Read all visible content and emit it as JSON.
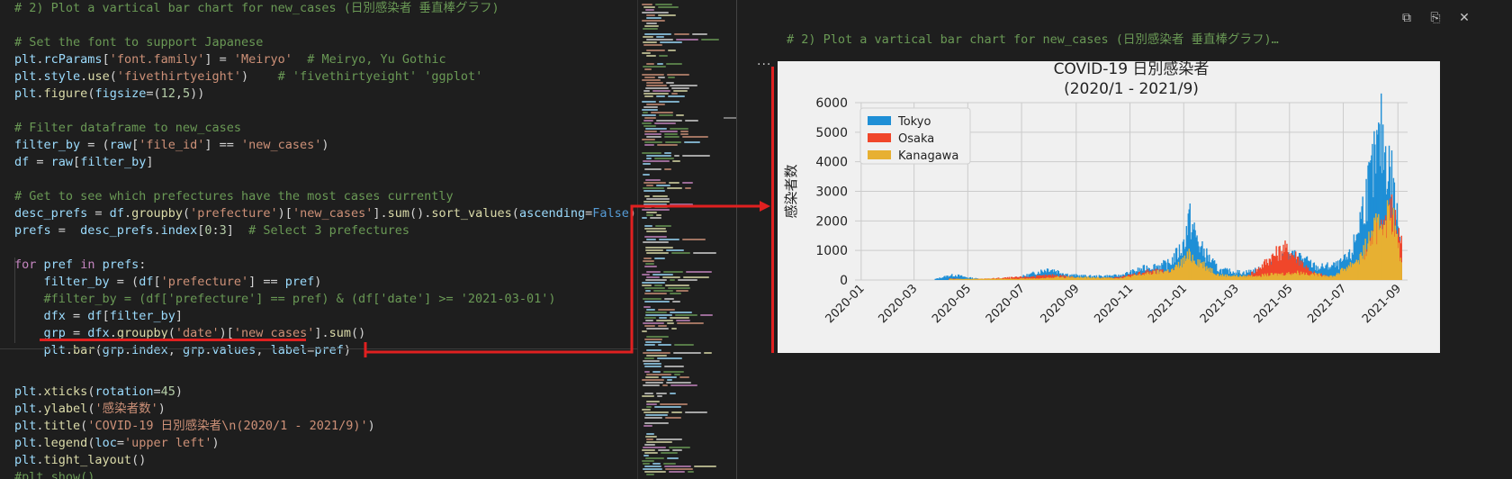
{
  "editor": {
    "lines": [
      {
        "tokens": [
          [
            "c-comment",
            "# 2) Plot a vartical bar chart for new_cases (日別感染者 垂直棒グラフ)"
          ]
        ]
      },
      {
        "tokens": []
      },
      {
        "tokens": [
          [
            "c-comment",
            "# Set the font to support Japanese"
          ]
        ]
      },
      {
        "tokens": [
          [
            "c-ident",
            "plt"
          ],
          [
            "c-plain",
            "."
          ],
          [
            "c-ident",
            "rcParams"
          ],
          [
            "c-plain",
            "["
          ],
          [
            "c-str",
            "'font.family'"
          ],
          [
            "c-plain",
            "] = "
          ],
          [
            "c-str",
            "'Meiryo'"
          ],
          [
            "c-plain",
            "  "
          ],
          [
            "c-comment",
            "# Meiryo, Yu Gothic"
          ]
        ]
      },
      {
        "tokens": [
          [
            "c-ident",
            "plt"
          ],
          [
            "c-plain",
            "."
          ],
          [
            "c-ident",
            "style"
          ],
          [
            "c-plain",
            "."
          ],
          [
            "c-fn",
            "use"
          ],
          [
            "c-plain",
            "("
          ],
          [
            "c-str",
            "'fivethirtyeight'"
          ],
          [
            "c-plain",
            ")    "
          ],
          [
            "c-comment",
            "# 'fivethirtyeight' 'ggplot'"
          ]
        ]
      },
      {
        "tokens": [
          [
            "c-ident",
            "plt"
          ],
          [
            "c-plain",
            "."
          ],
          [
            "c-fn",
            "figure"
          ],
          [
            "c-plain",
            "("
          ],
          [
            "c-ident",
            "figsize"
          ],
          [
            "c-plain",
            "=("
          ],
          [
            "c-num",
            "12"
          ],
          [
            "c-plain",
            ","
          ],
          [
            "c-num",
            "5"
          ],
          [
            "c-plain",
            "))"
          ]
        ]
      },
      {
        "tokens": []
      },
      {
        "tokens": [
          [
            "c-comment",
            "# Filter dataframe to new_cases"
          ]
        ]
      },
      {
        "tokens": [
          [
            "c-ident",
            "filter_by"
          ],
          [
            "c-plain",
            " = ("
          ],
          [
            "c-ident",
            "raw"
          ],
          [
            "c-plain",
            "["
          ],
          [
            "c-str",
            "'file_id'"
          ],
          [
            "c-plain",
            "] == "
          ],
          [
            "c-str",
            "'new_cases'"
          ],
          [
            "c-plain",
            ")"
          ]
        ]
      },
      {
        "tokens": [
          [
            "c-ident",
            "df"
          ],
          [
            "c-plain",
            " = "
          ],
          [
            "c-ident",
            "raw"
          ],
          [
            "c-plain",
            "["
          ],
          [
            "c-ident",
            "filter_by"
          ],
          [
            "c-plain",
            "]"
          ]
        ]
      },
      {
        "tokens": []
      },
      {
        "tokens": [
          [
            "c-comment",
            "# Get to see which prefectures have the most cases currently"
          ]
        ]
      },
      {
        "tokens": [
          [
            "c-ident",
            "desc_prefs"
          ],
          [
            "c-plain",
            " = "
          ],
          [
            "c-ident",
            "df"
          ],
          [
            "c-plain",
            "."
          ],
          [
            "c-fn",
            "groupby"
          ],
          [
            "c-plain",
            "("
          ],
          [
            "c-str",
            "'prefecture'"
          ],
          [
            "c-plain",
            ")["
          ],
          [
            "c-str",
            "'new_cases'"
          ],
          [
            "c-plain",
            "]."
          ],
          [
            "c-fn",
            "sum"
          ],
          [
            "c-plain",
            "()."
          ],
          [
            "c-fn",
            "sort_values"
          ],
          [
            "c-plain",
            "("
          ],
          [
            "c-ident",
            "ascending"
          ],
          [
            "c-plain",
            "="
          ],
          [
            "c-const",
            "False"
          ],
          [
            "c-plain",
            ")"
          ]
        ]
      },
      {
        "tokens": [
          [
            "c-ident",
            "prefs"
          ],
          [
            "c-plain",
            " =  "
          ],
          [
            "c-ident",
            "desc_prefs"
          ],
          [
            "c-plain",
            "."
          ],
          [
            "c-ident",
            "index"
          ],
          [
            "c-plain",
            "["
          ],
          [
            "c-num",
            "0"
          ],
          [
            "c-plain",
            ":"
          ],
          [
            "c-num",
            "3"
          ],
          [
            "c-plain",
            "]  "
          ],
          [
            "c-comment",
            "# Select 3 prefectures"
          ]
        ]
      },
      {
        "tokens": []
      },
      {
        "tokens": [
          [
            "c-kw",
            "for"
          ],
          [
            "c-plain",
            " "
          ],
          [
            "c-ident",
            "pref"
          ],
          [
            "c-plain",
            " "
          ],
          [
            "c-kw",
            "in"
          ],
          [
            "c-plain",
            " "
          ],
          [
            "c-ident",
            "prefs"
          ],
          [
            "c-plain",
            ":"
          ]
        ]
      },
      {
        "tokens": [
          [
            "c-plain",
            "    "
          ],
          [
            "c-ident",
            "filter_by"
          ],
          [
            "c-plain",
            " = ("
          ],
          [
            "c-ident",
            "df"
          ],
          [
            "c-plain",
            "["
          ],
          [
            "c-str",
            "'prefecture'"
          ],
          [
            "c-plain",
            "] == "
          ],
          [
            "c-ident",
            "pref"
          ],
          [
            "c-plain",
            ")"
          ]
        ]
      },
      {
        "tokens": [
          [
            "c-plain",
            "    "
          ],
          [
            "c-comment",
            "#filter_by = (df['prefecture'] == pref) & (df['date'] >= '2021-03-01')"
          ]
        ]
      },
      {
        "tokens": [
          [
            "c-plain",
            "    "
          ],
          [
            "c-ident",
            "dfx"
          ],
          [
            "c-plain",
            " = "
          ],
          [
            "c-ident",
            "df"
          ],
          [
            "c-plain",
            "["
          ],
          [
            "c-ident",
            "filter_by"
          ],
          [
            "c-plain",
            "]"
          ]
        ]
      },
      {
        "tokens": [
          [
            "c-plain",
            "    "
          ],
          [
            "c-ident",
            "grp"
          ],
          [
            "c-plain",
            " = "
          ],
          [
            "c-ident",
            "dfx"
          ],
          [
            "c-plain",
            "."
          ],
          [
            "c-fn",
            "groupby"
          ],
          [
            "c-plain",
            "("
          ],
          [
            "c-str",
            "'date'"
          ],
          [
            "c-plain",
            ")["
          ],
          [
            "c-str",
            "'new_cases'"
          ],
          [
            "c-plain",
            "]."
          ],
          [
            "c-fn",
            "sum"
          ],
          [
            "c-plain",
            "()"
          ]
        ]
      },
      {
        "tokens": [
          [
            "c-plain",
            "    "
          ],
          [
            "c-ident",
            "plt"
          ],
          [
            "c-plain",
            "."
          ],
          [
            "c-fn",
            "bar"
          ],
          [
            "c-plain",
            "("
          ],
          [
            "c-ident",
            "grp"
          ],
          [
            "c-plain",
            "."
          ],
          [
            "c-ident",
            "index"
          ],
          [
            "c-plain",
            ", "
          ],
          [
            "c-ident",
            "grp"
          ],
          [
            "c-plain",
            "."
          ],
          [
            "c-ident",
            "values"
          ],
          [
            "c-plain",
            ", "
          ],
          [
            "c-ident",
            "label"
          ],
          [
            "c-plain",
            "="
          ],
          [
            "c-ident",
            "pref"
          ],
          [
            "c-plain",
            ")"
          ]
        ]
      },
      {
        "tokens": []
      },
      {
        "tokens": [
          [
            "c-ident",
            "plt"
          ],
          [
            "c-plain",
            "."
          ],
          [
            "c-fn",
            "xticks"
          ],
          [
            "c-plain",
            "("
          ],
          [
            "c-ident",
            "rotation"
          ],
          [
            "c-plain",
            "="
          ],
          [
            "c-num",
            "45"
          ],
          [
            "c-plain",
            ")"
          ]
        ]
      },
      {
        "tokens": [
          [
            "c-ident",
            "plt"
          ],
          [
            "c-plain",
            "."
          ],
          [
            "c-fn",
            "ylabel"
          ],
          [
            "c-plain",
            "("
          ],
          [
            "c-str",
            "'感染者数'"
          ],
          [
            "c-plain",
            ")"
          ]
        ]
      },
      {
        "tokens": [
          [
            "c-ident",
            "plt"
          ],
          [
            "c-plain",
            "."
          ],
          [
            "c-fn",
            "title"
          ],
          [
            "c-plain",
            "("
          ],
          [
            "c-str",
            "'COVID-19 日別感染者\\n(2020/1 - 2021/9)'"
          ],
          [
            "c-plain",
            ")"
          ]
        ]
      },
      {
        "tokens": [
          [
            "c-ident",
            "plt"
          ],
          [
            "c-plain",
            "."
          ],
          [
            "c-fn",
            "legend"
          ],
          [
            "c-plain",
            "("
          ],
          [
            "c-ident",
            "loc"
          ],
          [
            "c-plain",
            "="
          ],
          [
            "c-str",
            "'upper left'"
          ],
          [
            "c-plain",
            ")"
          ]
        ]
      },
      {
        "tokens": [
          [
            "c-ident",
            "plt"
          ],
          [
            "c-plain",
            "."
          ],
          [
            "c-fn",
            "tight_layout"
          ],
          [
            "c-plain",
            "()"
          ]
        ]
      },
      {
        "tokens": [
          [
            "c-comment",
            "#plt.show()"
          ]
        ]
      }
    ]
  },
  "output": {
    "code_title": "# 2) Plot a vartical bar chart for new_cases (日別感染者 垂直棒グラフ)…",
    "ellipsis": "···",
    "toolbar": {
      "copy_icon_glyph": "⧉",
      "paste_icon_glyph": "⎘",
      "close_icon_glyph": "✕"
    }
  },
  "colors": {
    "tokyo": "#1f8fd6",
    "osaka": "#f0462a",
    "kanagawa": "#e7b032",
    "annotation": "#e02020"
  },
  "chart_data": {
    "type": "bar",
    "title": "COVID-19 日別感染者\n(2020/1 - 2021/9)",
    "title_lines": [
      "COVID-19 日別感染者",
      "(2020/1 - 2021/9)"
    ],
    "ylabel": "感染者数",
    "xlabel": "",
    "ylim": [
      0,
      6000
    ],
    "yticks": [
      "0",
      "1000",
      "2000",
      "3000",
      "4000",
      "5000",
      "6000"
    ],
    "ytick_values": [
      0,
      1000,
      2000,
      3000,
      4000,
      5000,
      6000
    ],
    "x_domain": [
      "2019-12-25",
      "2021-09-12"
    ],
    "xticks": [
      "2020-01",
      "2020-03",
      "2020-05",
      "2020-07",
      "2020-09",
      "2020-11",
      "2021-01",
      "2021-03",
      "2021-05",
      "2021-07",
      "2021-09"
    ],
    "grid": true,
    "legend_position": "upper left",
    "series": [
      {
        "name": "Tokyo",
        "values": [
          [
            "2020-03-25",
            40
          ],
          [
            "2020-04-10",
            180
          ],
          [
            "2020-04-17",
            200
          ],
          [
            "2020-05-01",
            100
          ],
          [
            "2020-05-25",
            10
          ],
          [
            "2020-06-20",
            50
          ],
          [
            "2020-07-10",
            220
          ],
          [
            "2020-08-01",
            460
          ],
          [
            "2020-08-25",
            200
          ],
          [
            "2020-09-20",
            150
          ],
          [
            "2020-10-20",
            180
          ],
          [
            "2020-11-20",
            500
          ],
          [
            "2020-12-15",
            650
          ],
          [
            "2020-12-31",
            1350
          ],
          [
            "2021-01-07",
            2500
          ],
          [
            "2021-01-20",
            1300
          ],
          [
            "2021-02-10",
            400
          ],
          [
            "2021-03-10",
            300
          ],
          [
            "2021-04-01",
            450
          ],
          [
            "2021-04-25",
            850
          ],
          [
            "2021-05-10",
            1000
          ],
          [
            "2021-06-01",
            500
          ],
          [
            "2021-06-25",
            600
          ],
          [
            "2021-07-10",
            1000
          ],
          [
            "2021-07-25",
            3200
          ],
          [
            "2021-08-05",
            4600
          ],
          [
            "2021-08-13",
            5800
          ],
          [
            "2021-08-25",
            4200
          ],
          [
            "2021-09-05",
            1200
          ]
        ]
      },
      {
        "name": "Osaka",
        "values": [
          [
            "2020-04-10",
            60
          ],
          [
            "2020-05-01",
            20
          ],
          [
            "2020-07-20",
            150
          ],
          [
            "2020-08-10",
            200
          ],
          [
            "2020-09-10",
            50
          ],
          [
            "2020-10-20",
            100
          ],
          [
            "2020-11-20",
            350
          ],
          [
            "2020-12-20",
            350
          ],
          [
            "2021-01-10",
            600
          ],
          [
            "2021-02-10",
            100
          ],
          [
            "2021-03-10",
            80
          ],
          [
            "2021-03-25",
            400
          ],
          [
            "2021-04-10",
            900
          ],
          [
            "2021-04-25",
            1260
          ],
          [
            "2021-05-10",
            900
          ],
          [
            "2021-05-25",
            300
          ],
          [
            "2021-06-20",
            100
          ],
          [
            "2021-07-20",
            600
          ],
          [
            "2021-08-10",
            2000
          ],
          [
            "2021-08-25",
            2800
          ],
          [
            "2021-09-05",
            1500
          ]
        ]
      },
      {
        "name": "Kanagawa",
        "values": [
          [
            "2020-04-10",
            40
          ],
          [
            "2020-07-20",
            60
          ],
          [
            "2020-08-10",
            120
          ],
          [
            "2020-10-20",
            80
          ],
          [
            "2020-11-20",
            250
          ],
          [
            "2020-12-20",
            400
          ],
          [
            "2021-01-08",
            1000
          ],
          [
            "2021-02-10",
            200
          ],
          [
            "2021-03-10",
            150
          ],
          [
            "2021-04-25",
            250
          ],
          [
            "2021-05-10",
            300
          ],
          [
            "2021-06-20",
            150
          ],
          [
            "2021-07-20",
            900
          ],
          [
            "2021-08-10",
            2300
          ],
          [
            "2021-08-25",
            2700
          ],
          [
            "2021-09-05",
            600
          ]
        ]
      }
    ]
  }
}
